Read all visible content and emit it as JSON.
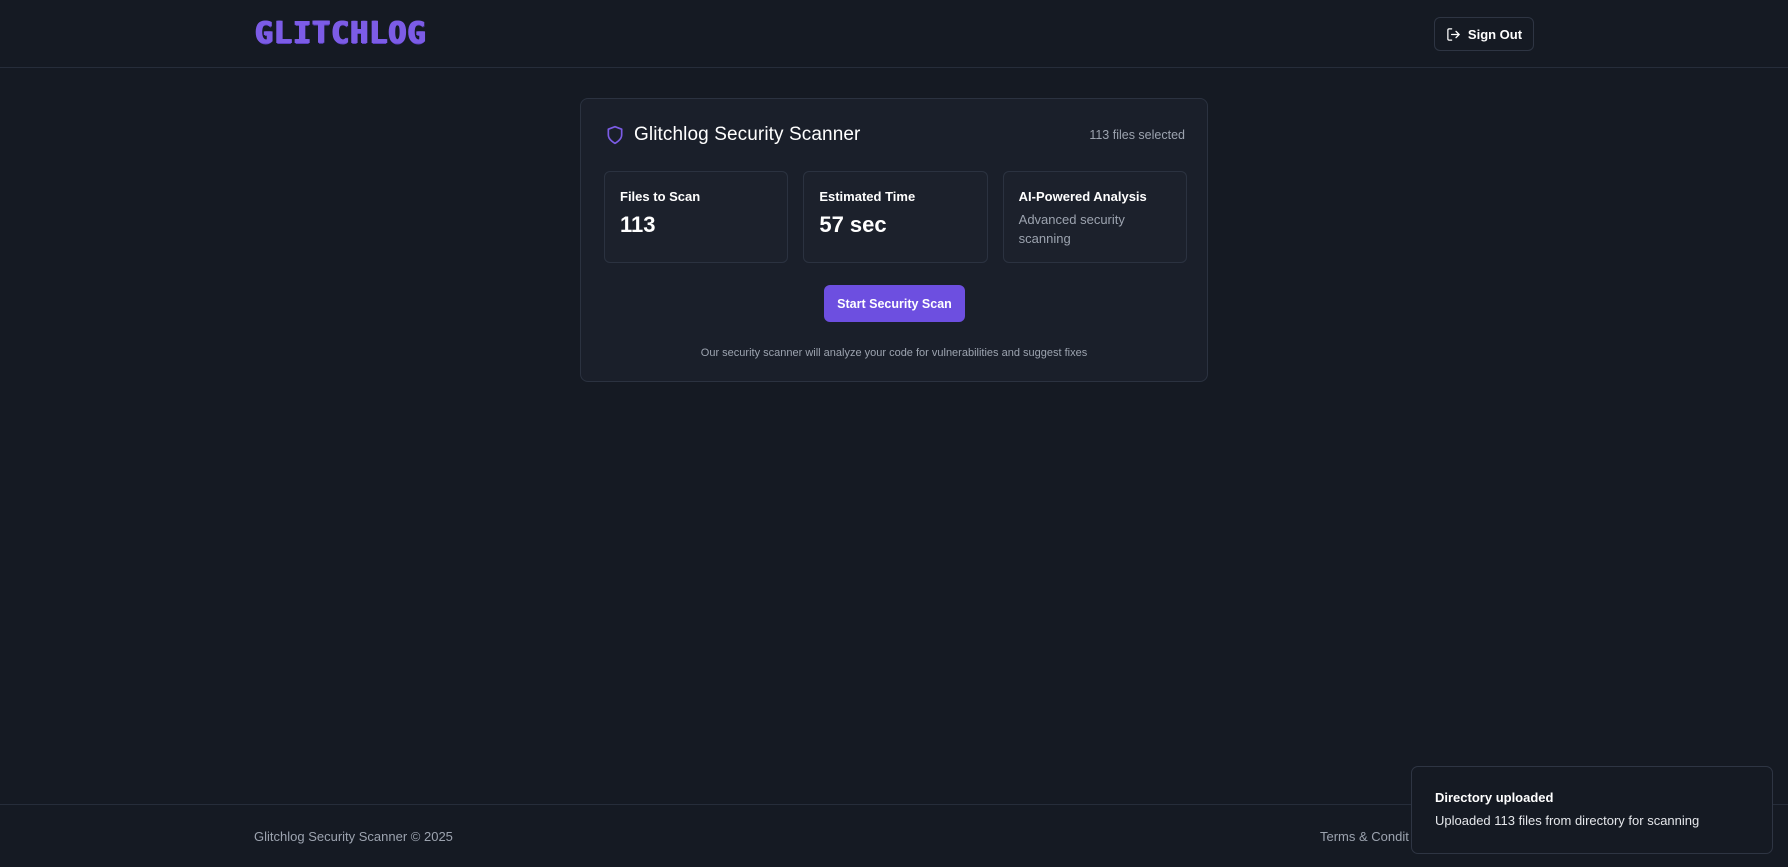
{
  "header": {
    "logo_text": "GLITCHLOG",
    "sign_out_label": "Sign Out",
    "sign_out_icon": "log-out-icon"
  },
  "scanner": {
    "icon": "shield-icon",
    "title": "Glitchlog Security Scanner",
    "files_selected": "113 files selected",
    "stats": [
      {
        "label": "Files to Scan",
        "value": "113"
      },
      {
        "label": "Estimated Time",
        "value": "57 sec"
      },
      {
        "label": "AI-Powered Analysis",
        "description": "Advanced security scanning"
      }
    ],
    "start_button_label": "Start Security Scan",
    "note": "Our security scanner will analyze your code for vulnerabilities and suggest fixes"
  },
  "footer": {
    "copyright": "Glitchlog Security Scanner © 2025",
    "terms_link": "Terms & Condit"
  },
  "toast": {
    "title": "Directory uploaded",
    "message": "Uploaded 113 files from directory for scanning"
  },
  "colors": {
    "background": "#151a23",
    "card": "#1a1f2a",
    "accent": "#6d4fe0",
    "logo": "#7c5ce6",
    "muted_text": "#9ca3af"
  }
}
